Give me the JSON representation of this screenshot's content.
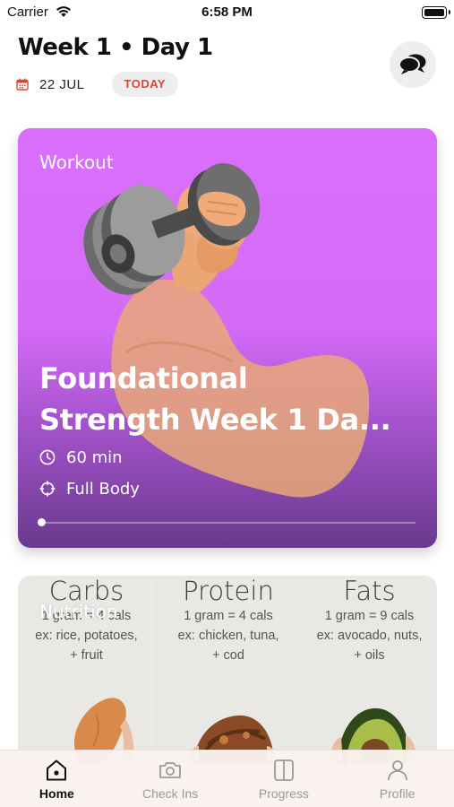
{
  "status_bar": {
    "carrier": "Carrier",
    "time": "6:58 PM"
  },
  "header": {
    "title": "Week 1 • Day 1",
    "date": "22 JUL",
    "today_label": "TODAY",
    "calendar_icon": "calendar-icon",
    "chat_icon": "chat-bubbles-icon"
  },
  "workout_card": {
    "label": "Workout",
    "title_line1": "Foundational",
    "title_line2": "Strength Week 1 Da...",
    "duration": "60 min",
    "focus": "Full Body",
    "progress": 0.0,
    "background_color": "#d96ffc"
  },
  "nutrition_card": {
    "label": "Nutrition",
    "macros": [
      {
        "name": "Carbs",
        "line1": "1 gram = 4 cals",
        "line2": "ex: rice, potatoes,",
        "line3": "+ fruit"
      },
      {
        "name": "Protein",
        "line1": "1 gram = 4 cals",
        "line2": "ex: chicken, tuna,",
        "line3": "+ cod"
      },
      {
        "name": "Fats",
        "line1": "1 gram = 9 cals",
        "line2": "ex: avocado, nuts,",
        "line3": "+ oils"
      }
    ]
  },
  "tab_bar": {
    "tabs": [
      {
        "label": "Home",
        "icon": "home-icon",
        "active": true
      },
      {
        "label": "Check Ins",
        "icon": "camera-icon",
        "active": false
      },
      {
        "label": "Progress",
        "icon": "progress-icon",
        "active": false
      },
      {
        "label": "Profile",
        "icon": "profile-icon",
        "active": false
      }
    ]
  },
  "colors": {
    "accent_today": "#e0442f",
    "tab_active": "#111111",
    "tab_inactive": "#9a9a9a"
  }
}
